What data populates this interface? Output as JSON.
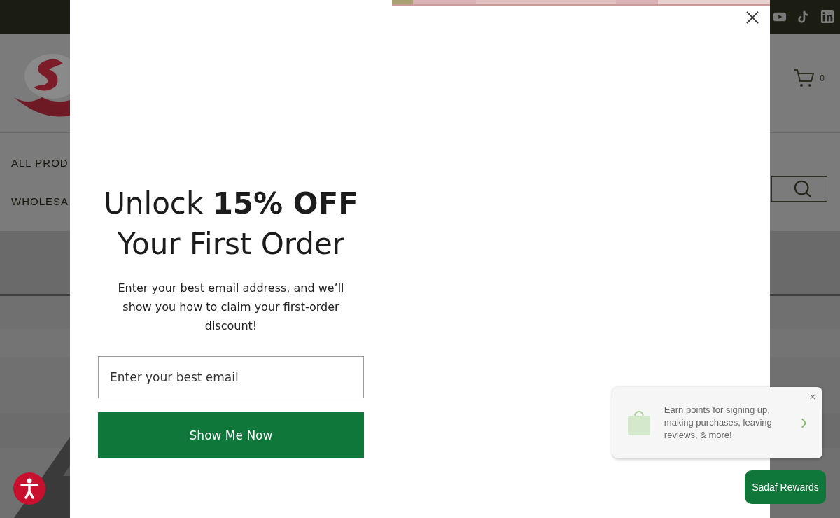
{
  "top_bar": {
    "social_links": [
      {
        "kind": "youtube"
      },
      {
        "kind": "tiktok"
      },
      {
        "kind": "linkedin"
      }
    ]
  },
  "header": {
    "cart_count": "0"
  },
  "nav": {
    "items": [
      "ALL PROD",
      "WHOLESA"
    ]
  },
  "popup": {
    "headline_1": "Unlock **15% OFF**",
    "headline_2": "Your First Order",
    "description": "Enter your best email address, and we’ll show you how to claim your first-order discount!",
    "email_field": {
      "placeholder": "Enter your best email"
    },
    "submit_button": "Show Me Now"
  },
  "rewards_teaser": {
    "message": "Earn points for signing up, making purchases, leaving reviews, & more!"
  },
  "rewards_button": "Sadaf Rewards"
}
